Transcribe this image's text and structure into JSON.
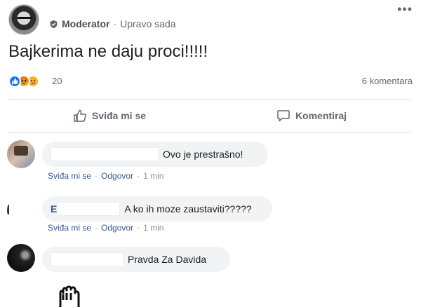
{
  "post": {
    "role": "Moderator",
    "separator": "·",
    "time": "Upravo sada",
    "more": "•••",
    "text": "Bajkerima ne daju proci!!!!!",
    "reactions": {
      "icons": [
        "like-icon",
        "angry-icon",
        "sad-icon"
      ],
      "count": "20"
    },
    "comments_count": "6 komentara"
  },
  "actions": {
    "like": "Sviđa mi se",
    "comment": "Komentiraj"
  },
  "comments": [
    {
      "text": "Ovo je prestrašno!",
      "like": "Sviđa mi se",
      "reply": "Odgovor",
      "time": "1 min",
      "sep": "·"
    },
    {
      "initial": "E",
      "text": "A ko ih moze zaustaviti?????",
      "like": "Sviđa mi se",
      "reply": "Odgovor",
      "time": "1 min",
      "sep": "·"
    },
    {
      "text": "Pravda Za Davida"
    }
  ],
  "colors": {
    "brand": "#1877f2",
    "link": "#385898",
    "muted": "#606770",
    "bubble": "#f2f3f5"
  }
}
